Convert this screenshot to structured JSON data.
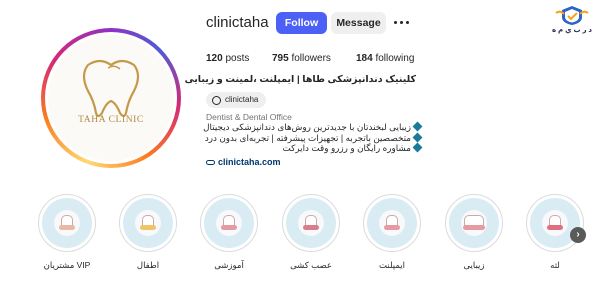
{
  "corner_logo": {
    "text": "د ر  ب ي م ه",
    "icon": "shield-logo-icon"
  },
  "profile": {
    "username": "clinictaha",
    "avatar_caption": "TAHA CLINIC",
    "follow_label": "Follow",
    "message_label": "Message",
    "more_icon": "more-horizontal-icon"
  },
  "stats": {
    "posts": {
      "count": "120",
      "label": " posts"
    },
    "followers": {
      "count": "795",
      "label": " followers"
    },
    "following": {
      "count": "184",
      "label": " following"
    }
  },
  "bio": {
    "title": "کلینیک دندانپزشکی طاها | ایمپلنت ،لمینت و زیبایی",
    "threads_handle": "clinictaha",
    "category": "Dentist & Dental Office",
    "lines": [
      "زیبایی لبخندتان با جدیدترین روش‌های دندانپزشکی دیجیتال",
      "متخصصین باتجربه | تجهیزات پیشرفته | تجربه‌ای بدون درد",
      "مشاوره رایگان و رزرو وقت دایرکت"
    ],
    "link": "clinictaha.com"
  },
  "highlights": [
    {
      "label": "مشتریان VIP"
    },
    {
      "label": "اطفال"
    },
    {
      "label": "آموزشی"
    },
    {
      "label": "عصب کشی"
    },
    {
      "label": "ایمپلنت"
    },
    {
      "label": "زیبایی"
    },
    {
      "label": "لثه"
    }
  ],
  "colors": {
    "follow_button": "#4c60f5",
    "message_button": "#efefef",
    "link": "#00376b",
    "highlight_bg": "#d9ecf3",
    "bullet": "#1a7a9c"
  }
}
